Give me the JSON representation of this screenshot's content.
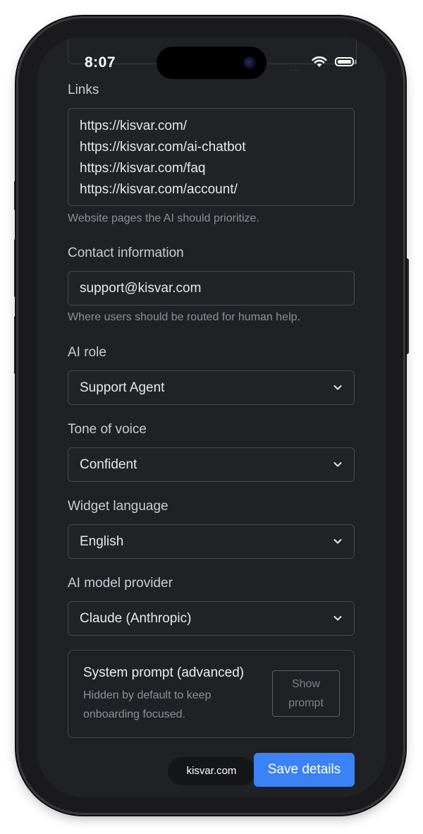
{
  "status_bar": {
    "time": "8:07",
    "signal": "....",
    "icons": [
      "wifi-icon",
      "battery-icon"
    ]
  },
  "form": {
    "links": {
      "label": "Links",
      "lines": [
        "https://kisvar.com/",
        "https://kisvar.com/ai-chatbot",
        "https://kisvar.com/faq",
        "https://kisvar.com/account/"
      ],
      "hint": "Website pages the AI should prioritize."
    },
    "contact": {
      "label": "Contact information",
      "value": "support@kisvar.com",
      "hint": "Where users should be routed for human help."
    },
    "ai_role": {
      "label": "AI role",
      "value": "Support Agent"
    },
    "tone": {
      "label": "Tone of voice",
      "value": "Confident"
    },
    "language": {
      "label": "Widget language",
      "value": "English"
    },
    "provider": {
      "label": "AI model provider",
      "value": "Claude (Anthropic)"
    },
    "advanced": {
      "title": "System prompt (advanced)",
      "desc_line1": "Hidden by default to keep",
      "desc_line2": "onboarding focused.",
      "button_line1": "Show",
      "button_line2": "prompt"
    }
  },
  "footer": {
    "domain": "kisvar.com",
    "save_label": "Save details"
  },
  "colors": {
    "background": "#202124",
    "accent": "#3b82f6",
    "field_border": "#45484d"
  }
}
